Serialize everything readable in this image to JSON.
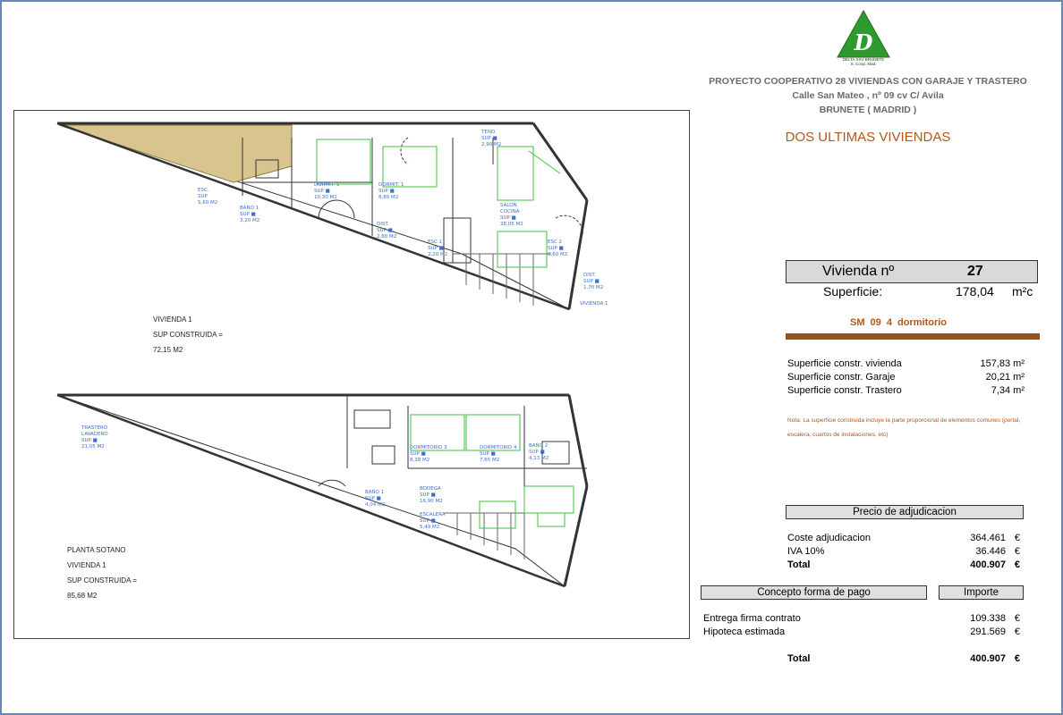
{
  "logo": {
    "letter": "D",
    "caption_line1": "DELTA XXV BRUNETE",
    "caption_line2": "S. Coop. Mad.",
    "colors": {
      "triangle": "#2e9a2e",
      "letter": "#ffffff"
    }
  },
  "project": {
    "title": "PROYECTO COOPERATIVO 28 VIVIENDAS CON GARAJE Y TRASTERO",
    "address": "Calle San Mateo , nº 09 cv C/ Avila",
    "city": "BRUNETE ( MADRID )"
  },
  "headline": "DOS ULTIMAS VIVIENDAS",
  "vivienda": {
    "label": "Vivienda nº",
    "number": "27",
    "superficie_label": "Superficie:",
    "superficie_value": "178,04",
    "superficie_unit": "m²c"
  },
  "type_line": "SM 09  4  dormitorio",
  "surfaces": [
    {
      "label": "Superficie constr. vivienda",
      "value": "157,83 m²"
    },
    {
      "label": "Superficie constr. Garaje",
      "value": "20,21 m²"
    },
    {
      "label": "Superficie constr. Trastero",
      "value": "7,34 m²"
    }
  ],
  "note": "Nota: La superficie construida incluye la parte proporcional de elementos comunes (portal, escalera, cuartos de instalaciones, etc)",
  "price": {
    "header": "Precio de adjudicacion",
    "rows": [
      {
        "label": "Coste adjudicacion",
        "value": "364.461",
        "currency": "€"
      },
      {
        "label": "IVA 10%",
        "value": "36.446",
        "currency": "€"
      },
      {
        "label": "Total",
        "value": "400.907",
        "currency": "€"
      }
    ]
  },
  "payment": {
    "header_concept": "Concepto forma de pago",
    "header_amount": "Importe",
    "rows": [
      {
        "label": "Entrega firma contrato",
        "value": "109.338",
        "currency": "€"
      },
      {
        "label": "Hipoteca estimada",
        "value": "291.569",
        "currency": "€"
      }
    ],
    "total_label": "Total",
    "total_value": "400.907",
    "total_currency": "€"
  },
  "plan": {
    "upper_block": [
      "VIVIENDA 1",
      "SUP CONSTRUIDA =",
      "72,15 M2"
    ],
    "lower_block": [
      "PLANTA SOTANO",
      "VIVIENDA 1",
      "SUP CONSTRUIDA =",
      "85,68 M2"
    ],
    "room_labels": [
      "ESC.",
      "SUP",
      "5,60 M2",
      "BAÑO 1",
      "SUP ■",
      "3,20 M2",
      "DORMIT. 1",
      "SUP ■",
      "10,30 M2",
      "DORMIT. 1",
      "SUP ■",
      "8,80 M2",
      "DIST.",
      "SUP ■",
      "2,60 M2",
      "TEND.",
      "SUP ■",
      "2,90 M2",
      "SALON",
      "COCINA",
      "SUP ■",
      "28,05 M2",
      "ESC 1",
      "SUP ■",
      "2,20 M2",
      "ESC 2",
      "SUP ■",
      "6,60 M2",
      "DIST.",
      "SUP ■",
      "1,70 M2",
      "VIVIENDA 1",
      "TRASTERO",
      "LAVADERO",
      "SUP ■",
      "21,05 M2",
      "DORMITORIO 3",
      "SUP ■",
      "8,38 M2",
      "DORMITORIO 4",
      "SUP ■",
      "7,65 M2",
      "BAÑO 2",
      "SUP ■",
      "4,13 M2",
      "BAÑO 1",
      "SUP ■",
      "4,04 M2",
      "BODEGA",
      "SUP ■",
      "16,90 M2",
      "ESCALERA",
      "SUP ■",
      "5,49 M2"
    ]
  }
}
